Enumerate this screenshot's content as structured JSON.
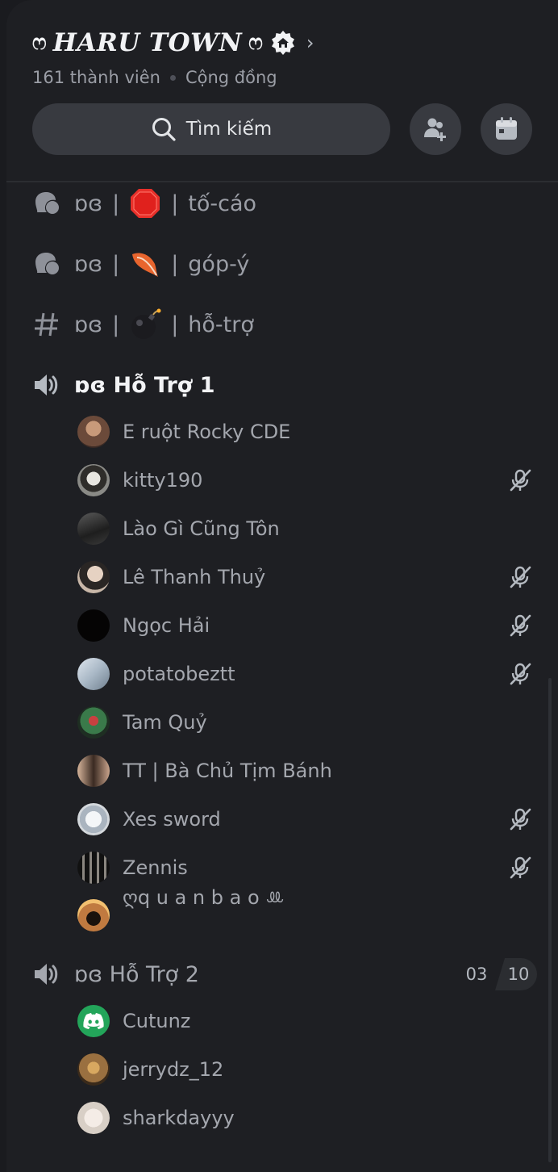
{
  "server": {
    "name": "HARU TOWN",
    "ornament": "ෆ",
    "members": "161 thành viên",
    "type": "Cộng đồng"
  },
  "search": {
    "label": "Tìm kiếm"
  },
  "channels": [
    {
      "prefix": "ɒɞ",
      "emoji": "stop-sign",
      "name": "tố-cáo",
      "icon": "forum-icon"
    },
    {
      "prefix": "ɒɞ",
      "emoji": "feather",
      "name": "góp-ý",
      "icon": "forum-icon"
    },
    {
      "prefix": "ɒɞ",
      "emoji": "bomb",
      "name": "hỗ-trợ",
      "icon": "hash-icon"
    }
  ],
  "voice1": {
    "name": "ɒɞ Hỗ Trợ 1",
    "members": [
      {
        "name": "E ruột Rocky CDE",
        "muted": false,
        "color": "#6b4a3a"
      },
      {
        "name": "kitty190",
        "muted": true,
        "color": "#8a8a86"
      },
      {
        "name": "Lào Gì Cũng Tôn",
        "muted": false,
        "color": "#3a3a3a"
      },
      {
        "name": "Lê Thanh Thuỷ",
        "muted": true,
        "color": "#c8b7a8"
      },
      {
        "name": "Ngọc Hải",
        "muted": true,
        "color": "#050404"
      },
      {
        "name": "potatobeztt",
        "muted": true,
        "color": "#a9b8c6"
      },
      {
        "name": "Tam Quỷ",
        "muted": false,
        "color": "#4b6a4e"
      },
      {
        "name": "TT | Bà Chủ Tịm Bánh",
        "muted": false,
        "color": "#7a5a48"
      },
      {
        "name": "Xes sword",
        "muted": true,
        "color": "#d4d8dc"
      },
      {
        "name": "Zennis",
        "muted": true,
        "color": "#2a2826"
      },
      {
        "name": "ღq u a n b a o ꔛ",
        "muted": false,
        "color": "#c07a40"
      }
    ]
  },
  "voice2": {
    "name": "ɒɞ Hỗ Trợ 2",
    "count": "03",
    "limit": "10",
    "members": [
      {
        "name": "Cutunz",
        "color": "#23a55a"
      },
      {
        "name": "jerrydz_12",
        "color": "#9a7040"
      },
      {
        "name": "sharkdayyy",
        "color": "#d8cfc6"
      }
    ]
  }
}
